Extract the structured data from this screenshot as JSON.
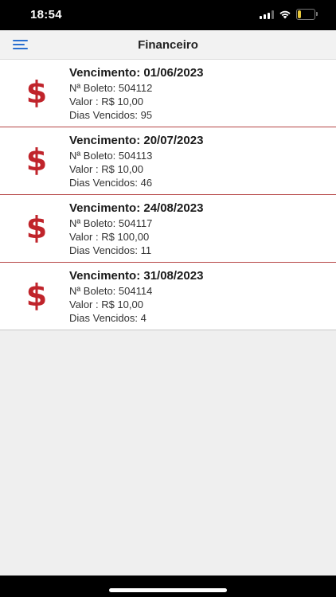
{
  "status_bar": {
    "time": "18:54",
    "battery_level": "19",
    "battery_color": "#e9c93a"
  },
  "header": {
    "title": "Financeiro",
    "menu_icon": "hamburger-menu-icon"
  },
  "colors": {
    "accent": "#2a6fd0",
    "dollar_icon": "#c0242b",
    "divider": "#b64545"
  },
  "boletos": [
    {
      "icon": "dollar-icon",
      "title": "Vencimento: 01/06/2023",
      "numero": "Nª Boleto: 504112",
      "valor": "Valor : R$ 10,00",
      "dias": "Dias Vencidos: 95"
    },
    {
      "icon": "dollar-icon",
      "title": "Vencimento: 20/07/2023",
      "numero": "Nª Boleto: 504113",
      "valor": "Valor : R$ 10,00",
      "dias": "Dias Vencidos: 46"
    },
    {
      "icon": "dollar-icon",
      "title": "Vencimento: 24/08/2023",
      "numero": "Nª Boleto: 504117",
      "valor": "Valor : R$ 100,00",
      "dias": "Dias Vencidos: 11"
    },
    {
      "icon": "dollar-icon",
      "title": "Vencimento: 31/08/2023",
      "numero": "Nª Boleto: 504114",
      "valor": "Valor : R$ 10,00",
      "dias": "Dias Vencidos: 4"
    }
  ]
}
